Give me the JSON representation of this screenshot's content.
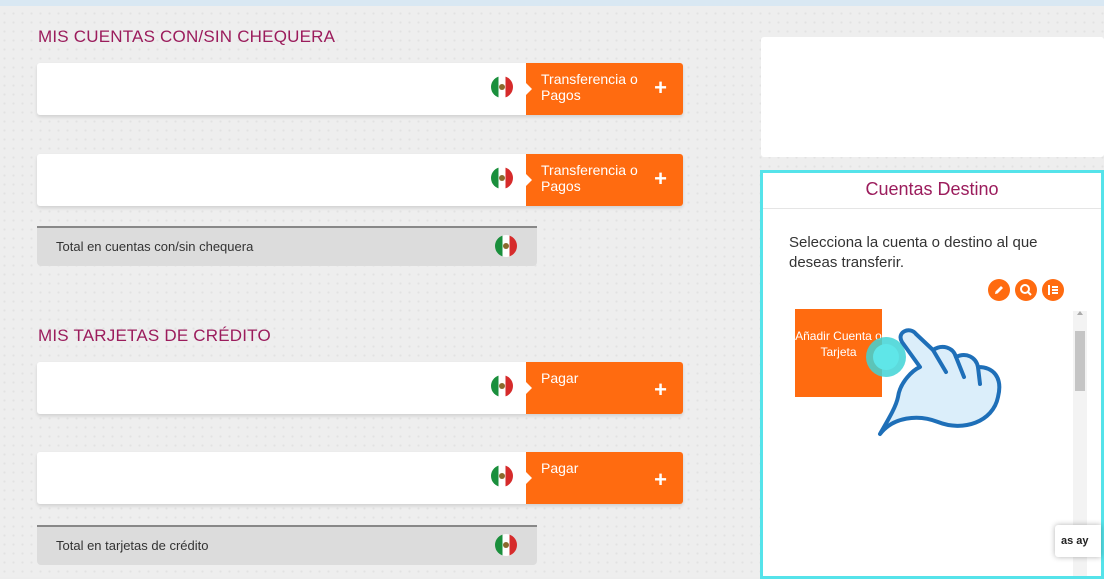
{
  "accounts_section": {
    "title": "MIS CUENTAS CON/SIN CHEQUERA",
    "rows": [
      {
        "action_label": "Transferencia o Pagos",
        "flag": "mexico-flag-icon"
      },
      {
        "action_label": "Transferencia o Pagos",
        "flag": "mexico-flag-icon"
      }
    ],
    "total_label": "Total en cuentas con/sin chequera"
  },
  "cards_section": {
    "title": "MIS TARJETAS DE CRÉDITO",
    "rows": [
      {
        "action_label": "Pagar",
        "flag": "mexico-flag-icon"
      },
      {
        "action_label": "Pagar",
        "flag": "mexico-flag-icon"
      }
    ],
    "total_label": "Total en tarjetas de crédito"
  },
  "destination_panel": {
    "title": "Cuentas Destino",
    "description": "Selecciona la cuenta o destino al que deseas transferir.",
    "tools": [
      "pencil-icon",
      "search-icon",
      "list-icon"
    ],
    "add_tile_label": "Añadir Cuenta o Tarjeta",
    "chat_snippet": "as ay"
  },
  "colors": {
    "accent": "#ff6b10",
    "brand_title": "#9b1c5c",
    "highlight_border": "#55e3ea",
    "hand_fill": "#dbeefa",
    "hand_stroke": "#1e6fb8"
  }
}
